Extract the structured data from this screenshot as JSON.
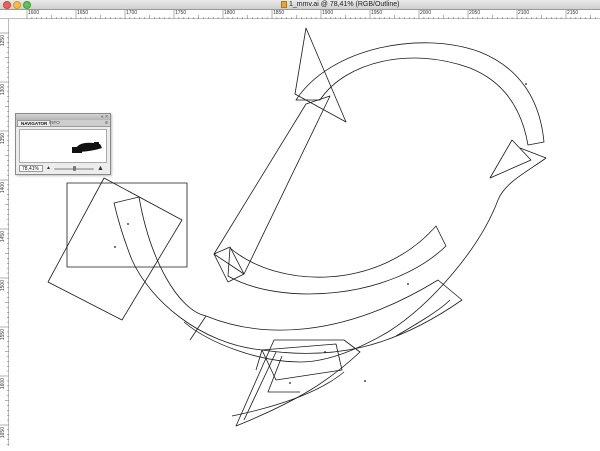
{
  "window": {
    "title": "1_mmv.ai @ 78,41% (RGB/Outline)",
    "close_icon": "close-icon",
    "minimize_icon": "minimize-icon",
    "zoom_icon": "zoom-icon",
    "document_icon": "illustrator-document-icon"
  },
  "rulers": {
    "top_labels": [
      "1600",
      "1650",
      "1700",
      "1750",
      "1800",
      "1850",
      "1900",
      "1950",
      "2000",
      "2050",
      "2100",
      "2150"
    ],
    "left_labels": [
      "1250",
      "1300",
      "1350",
      "1400",
      "1450",
      "1500",
      "1550",
      "1600",
      "1650"
    ]
  },
  "navigator": {
    "tabs": [
      {
        "label": "NAVIGATOR",
        "active": true
      },
      {
        "label": "INFO",
        "active": false
      }
    ],
    "header_controls": "« ×",
    "menu_icon": "≡",
    "zoom_value": "78,41%",
    "zoom_out_icon": "zoom-out-mountain-icon",
    "zoom_in_icon": "zoom-in-mountain-icon",
    "zoom_slider_level": 0.5
  },
  "colors": {
    "outline_stroke": "#1a1a1a",
    "titlebar": "#dcdcdc",
    "canvas": "#ffffff"
  }
}
